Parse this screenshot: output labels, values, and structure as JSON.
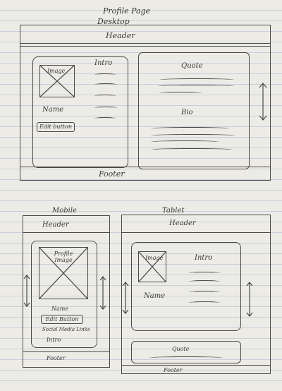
{
  "title": "Profile Page",
  "desktop": {
    "label": "Desktop",
    "header": "Header",
    "intro": "Intro",
    "image": "Image",
    "name": "Name",
    "edit_button": "Edit button",
    "quote": "Quote",
    "bio": "Bio",
    "footer": "Footer"
  },
  "mobile": {
    "label": "Mobile",
    "header": "Header",
    "image": "Profile Image",
    "name": "Name",
    "edit_button": "Edit Button",
    "social": "Social Media Links",
    "intro": "Intro",
    "footer": "Footer"
  },
  "tablet": {
    "label": "Tablet",
    "header": "Header",
    "image": "Image",
    "intro": "Intro",
    "name": "Name",
    "quote": "Quote",
    "footer": "Footer"
  }
}
